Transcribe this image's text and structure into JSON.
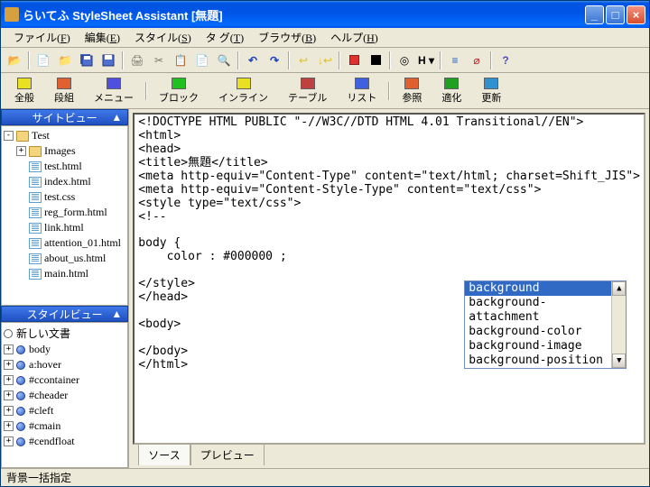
{
  "titlebar": {
    "title": "らいてふ StyleSheet Assistant  [無題]"
  },
  "menubar": {
    "items": [
      {
        "label": "ファイル(",
        "hotkey": "F",
        "suffix": ")"
      },
      {
        "label": "編集(",
        "hotkey": "E",
        "suffix": ")"
      },
      {
        "label": "スタイル(",
        "hotkey": "S",
        "suffix": ")"
      },
      {
        "label": "タ グ(",
        "hotkey": "T",
        "suffix": ")"
      },
      {
        "label": "ブラウザ(",
        "hotkey": "B",
        "suffix": ")"
      },
      {
        "label": "ヘルプ(",
        "hotkey": "H",
        "suffix": ")"
      }
    ]
  },
  "toolbar2": {
    "items": [
      {
        "label": "全般",
        "color": "#e8e020"
      },
      {
        "label": "段組",
        "color": "#e06030"
      },
      {
        "label": "メニュー",
        "color": "#5050e0"
      },
      {
        "label": "ブロック",
        "color": "#20c020"
      },
      {
        "label": "インライン",
        "color": "#e8e020"
      },
      {
        "label": "テーブル",
        "color": "#c04040"
      },
      {
        "label": "リスト",
        "color": "#4060e0"
      },
      {
        "label": "参照",
        "color": "#e06030"
      },
      {
        "label": "適化",
        "color": "#20a020"
      },
      {
        "label": "更新",
        "color": "#3090d0"
      }
    ]
  },
  "sidebar": {
    "panel1": {
      "title": "サイトビュー",
      "root": "Test",
      "folder": "Images",
      "files": [
        "test.html",
        "index.html",
        "test.css",
        "reg_form.html",
        "link.html",
        "attention_01.html",
        "about_us.html",
        "main.html"
      ]
    },
    "panel2": {
      "title": "スタイルビュー",
      "root": "新しい文書",
      "items": [
        "body",
        "a:hover",
        "#ccontainer",
        "#cheader",
        "#cleft",
        "#cmain",
        "#cendfloat"
      ]
    }
  },
  "editor": {
    "lines": [
      "<!DOCTYPE HTML PUBLIC \"-//W3C//DTD HTML 4.01 Transitional//EN\">",
      "<html>",
      "<head>",
      "<title>無題</title>",
      "<meta http-equiv=\"Content-Type\" content=\"text/html; charset=Shift_JIS\">",
      "<meta http-equiv=\"Content-Style-Type\" content=\"text/css\">",
      "<style type=\"text/css\">",
      "<!--",
      "",
      "body {",
      "    color : #000000 ;",
      "",
      "</style>",
      "</head>",
      "",
      "<body>",
      "",
      "</body>",
      "</html>"
    ],
    "autocomplete": {
      "items": [
        "background",
        "background-attachment",
        "background-color",
        "background-image",
        "background-position"
      ],
      "selected": 0
    }
  },
  "tabs": {
    "items": [
      "ソース",
      "プレビュー"
    ],
    "active": 0
  },
  "statusbar": {
    "text": "背景一括指定"
  }
}
